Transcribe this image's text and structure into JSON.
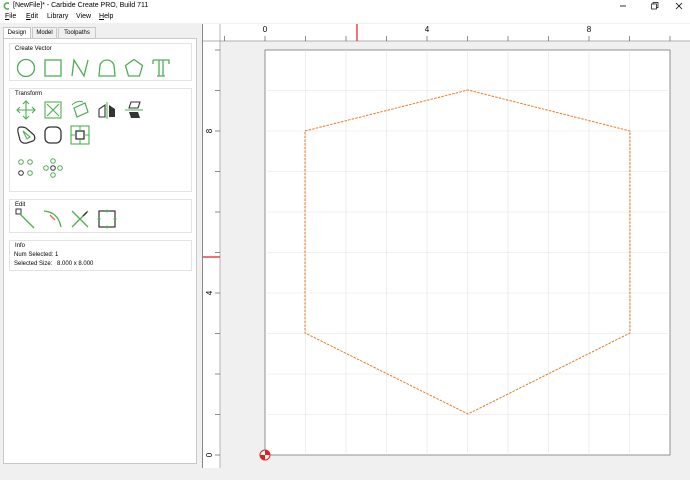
{
  "window": {
    "title": "[NewFile]* - Carbide Create PRO, Build 711"
  },
  "menu": {
    "file": "F",
    "file_rest": "ile",
    "edit": "E",
    "edit_rest": "dit",
    "library": "Library",
    "view": "View",
    "help": "H",
    "help_rest": "elp"
  },
  "tabs": [
    "Design",
    "Model",
    "Toolpaths"
  ],
  "groups": {
    "create_vector": "Create Vector",
    "transform": "Transform",
    "edit": "Edit",
    "info": "Info"
  },
  "info": {
    "num_selected_label": "Num Selected:",
    "num_selected": "1",
    "selected_size_label": "Selected Size:",
    "selected_size": "8.000 x 8.000"
  },
  "rulers": {
    "top_labels": [
      "0",
      "4",
      "8"
    ],
    "left_labels": [
      "8",
      "4",
      "0"
    ]
  },
  "colors": {
    "tool_green": "#4caf50",
    "shape_orange": "#f07820",
    "cursor_red": "#e02020"
  }
}
